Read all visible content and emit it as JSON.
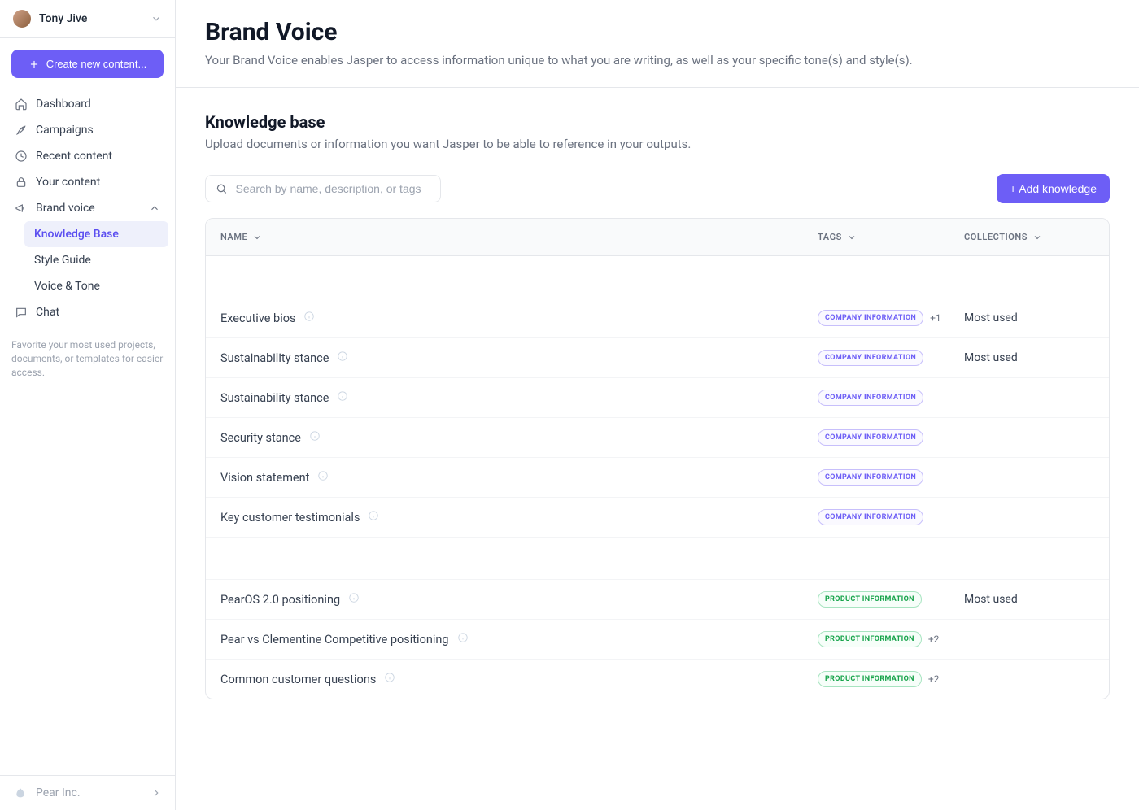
{
  "user": {
    "name": "Tony Jive"
  },
  "sidebar": {
    "create_label": "Create new content...",
    "nav": {
      "dashboard": "Dashboard",
      "campaigns": "Campaigns",
      "recent": "Recent content",
      "your_content": "Your content",
      "brand_voice": "Brand voice",
      "chat": "Chat"
    },
    "sub": {
      "knowledge_base": "Knowledge Base",
      "style_guide": "Style Guide",
      "voice_tone": "Voice & Tone"
    },
    "favorites_hint": "Favorite your most used projects, documents, or templates for easier access.",
    "org": "Pear Inc."
  },
  "header": {
    "title": "Brand Voice",
    "subtitle": "Your Brand Voice enables Jasper to access information unique to what you are writing, as well as your specific tone(s) and style(s)."
  },
  "knowledge": {
    "section_title": "Knowledge base",
    "section_desc": "Upload documents or information you want Jasper to be able to reference in your outputs.",
    "search_placeholder": "Search by name, description, or tags",
    "add_button": "+ Add knowledge",
    "columns": {
      "name": "NAME",
      "tags": "TAGS",
      "collections": "COLLECTIONS"
    },
    "rows": [
      {
        "name": "Executive bios",
        "tag": "COMPANY INFORMATION",
        "tag_type": "company",
        "extra": "+1",
        "collection": "Most used"
      },
      {
        "name": "Sustainability stance",
        "tag": "COMPANY INFORMATION",
        "tag_type": "company",
        "extra": "",
        "collection": "Most used"
      },
      {
        "name": "Sustainability stance",
        "tag": "COMPANY INFORMATION",
        "tag_type": "company",
        "extra": "",
        "collection": ""
      },
      {
        "name": "Security stance",
        "tag": "COMPANY INFORMATION",
        "tag_type": "company",
        "extra": "",
        "collection": ""
      },
      {
        "name": "Vision statement",
        "tag": "COMPANY INFORMATION",
        "tag_type": "company",
        "extra": "",
        "collection": ""
      },
      {
        "name": "Key customer testimonials",
        "tag": "COMPANY INFORMATION",
        "tag_type": "company",
        "extra": "",
        "collection": ""
      },
      {
        "name": "PearOS 2.0 positioning",
        "tag": "PRODUCT INFORMATION",
        "tag_type": "product",
        "extra": "",
        "collection": "Most used"
      },
      {
        "name": "Pear vs Clementine Competitive positioning",
        "tag": "PRODUCT INFORMATION",
        "tag_type": "product",
        "extra": "+2",
        "collection": ""
      },
      {
        "name": "Common customer questions",
        "tag": "PRODUCT INFORMATION",
        "tag_type": "product",
        "extra": "+2",
        "collection": ""
      }
    ]
  }
}
